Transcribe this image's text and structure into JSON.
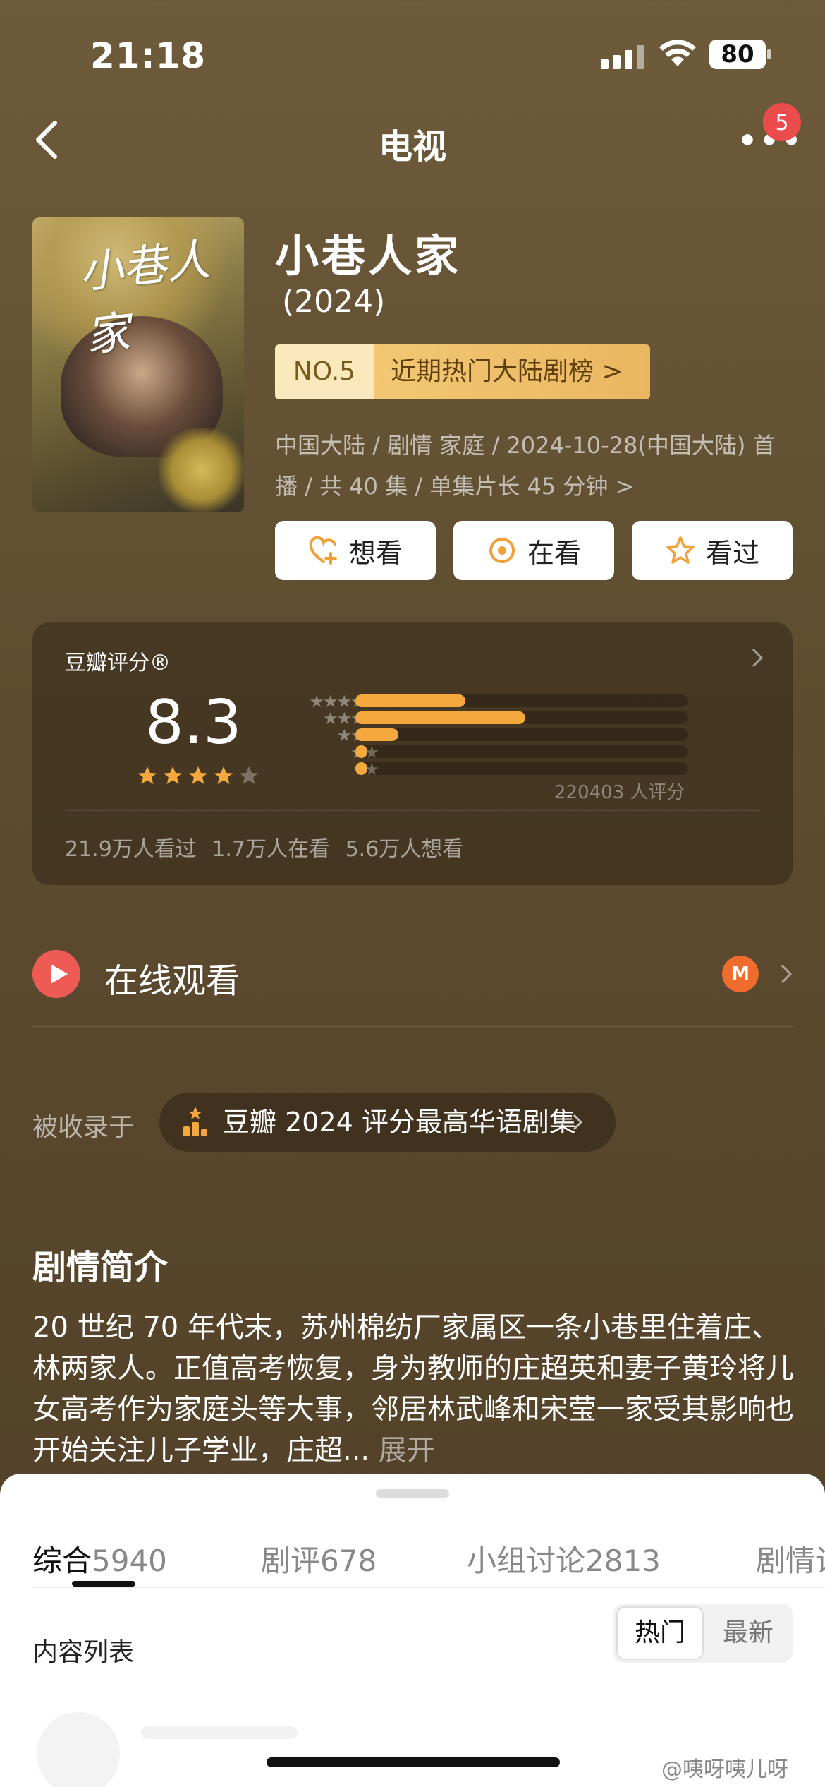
{
  "status_bar": {
    "time": "21:18",
    "battery": "80"
  },
  "nav": {
    "title": "电视",
    "more": "•••",
    "badge": "5"
  },
  "show": {
    "title": "小巷人家",
    "year": "(2024)",
    "poster_text": "小巷人家",
    "rank_no": "NO.5",
    "rank_label": "近期热门大陆剧榜 >",
    "meta_line1": "中国大陆 / 剧情 家庭 / 2024-10-28(中国大陆) 首",
    "meta_line2": "播 / 共 40 集 / 单集片长 45 分钟 >"
  },
  "actions": [
    {
      "label": "想看",
      "icon": "heart-plus-icon"
    },
    {
      "label": "在看",
      "icon": "target-icon"
    },
    {
      "label": "看过",
      "icon": "star-outline-icon"
    }
  ],
  "rating": {
    "label": "豆瓣评分®",
    "score": "8.3",
    "stars": 4,
    "star_levels": [
      "★★★★★",
      "★★★★",
      "★★★",
      "★★",
      "★"
    ],
    "distribution": [
      0.33,
      0.51,
      0.13,
      0.03,
      0.03
    ],
    "votes": "220403 人评分",
    "stats": "21.9万人看过   1.7万人在看   5.6万人想看"
  },
  "online": {
    "label": "在线观看",
    "platform_logo": "M"
  },
  "collected": {
    "label": "被收录于",
    "list": "豆瓣 2024 评分最高华语剧集"
  },
  "synopsis": {
    "title": "剧情简介",
    "text": "20 世纪 70 年代末，苏州棉纺厂家属区一条小巷里住着庄、林两家人。正值高考恢复，身为教师的庄超英和妻子黄玲将儿女高考作为家庭头等大事，邻居林武峰和宋莹一家受其影响也开始关注儿子学业，庄超...",
    "expand": "展开"
  },
  "sheet": {
    "tabs": [
      {
        "name": "综合",
        "count": "5940"
      },
      {
        "name": "剧评",
        "count": "678"
      },
      {
        "name": "小组讨论",
        "count": "2813"
      },
      {
        "name": "剧情讨",
        "count": ""
      }
    ],
    "list_title": "内容列表",
    "sort_hot": "热门",
    "sort_new": "最新"
  },
  "watermark": "@咦呀咦儿呀",
  "colors": {
    "accent": "#f4a83e",
    "play": "#ee5b55",
    "platform": "#ef6c2c"
  }
}
